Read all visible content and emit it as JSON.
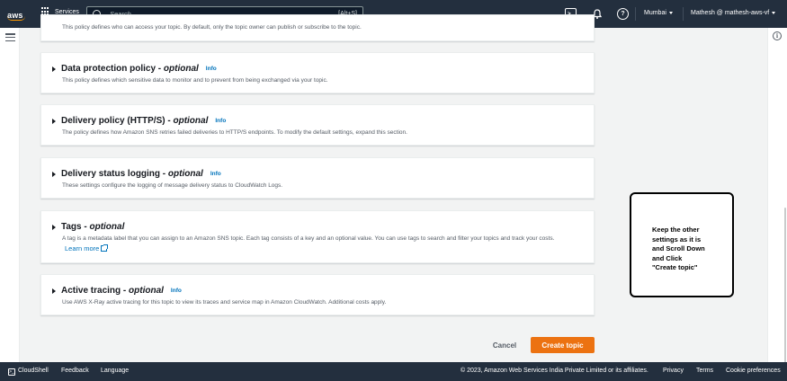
{
  "topnav": {
    "logo_text": "aws",
    "services_label": "Services",
    "search_placeholder": "Search",
    "search_shortcut": "[Alt+S]",
    "region": "Mumbai",
    "account": "Mathesh @ mathesh-aws-vf"
  },
  "sections": [
    {
      "title": "",
      "description": "This policy defines who can access your topic. By default, only the topic owner can publish or subscribe to the topic."
    },
    {
      "title": "Data protection policy - ",
      "title_optional": "optional",
      "info": "Info",
      "description": "This policy defines which sensitive data to monitor and to prevent from being exchanged via your topic."
    },
    {
      "title": "Delivery policy (HTTP/S) - ",
      "title_optional": "optional",
      "info": "Info",
      "description": "The policy defines how Amazon SNS retries failed deliveries to HTTP/S endpoints. To modify the default settings, expand this section."
    },
    {
      "title": "Delivery status logging - ",
      "title_optional": "optional",
      "info": "Info",
      "description": "These settings configure the logging of message delivery status to CloudWatch Logs."
    },
    {
      "title": "Tags - ",
      "title_optional": "optional",
      "info": "",
      "description": "A tag is a metadata label that you can assign to an Amazon SNS topic. Each tag consists of a key and an optional value. You can use tags to search and filter your topics and track your costs.",
      "learn_more": "Learn more"
    },
    {
      "title": "Active tracing - ",
      "title_optional": "optional",
      "info": "Info",
      "description": "Use AWS X-Ray active tracing for this topic to view its traces and service map in Amazon CloudWatch. Additional costs apply."
    }
  ],
  "actions": {
    "cancel": "Cancel",
    "create": "Create topic"
  },
  "annotation": {
    "text": "Keep the other settings as it is and Scroll Down and Click \"Create topic\""
  },
  "footer": {
    "cloudshell": "CloudShell",
    "feedback": "Feedback",
    "language": "Language",
    "copyright": "© 2023, Amazon Web Services India Private Limited or its affiliates.",
    "privacy": "Privacy",
    "terms": "Terms",
    "cookies": "Cookie preferences"
  },
  "colors": {
    "nav_bg": "#232f3e",
    "primary_button": "#ec7211",
    "link": "#0073bb",
    "page_bg": "#f2f3f3"
  }
}
